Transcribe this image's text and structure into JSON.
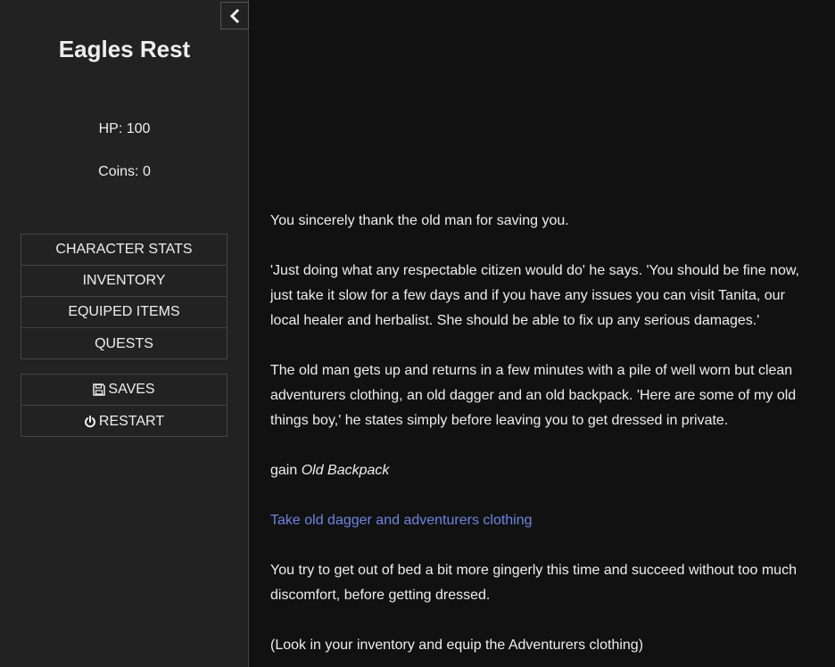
{
  "sidebar": {
    "title": "Eagles Rest",
    "hp": "HP: 100",
    "coins": "Coins: 0",
    "menu": {
      "character_stats": "CHARACTER STATS",
      "inventory": "INVENTORY",
      "equiped_items": "EQUIPED ITEMS",
      "quests": "QUESTS"
    },
    "system": {
      "saves": "SAVES",
      "restart": "RESTART"
    }
  },
  "passage": {
    "p1": "You sincerely thank the old man for saving you.",
    "p2": "'Just doing what any respectable citizen would do' he says. 'You should be fine now, just take it slow for a few days and if you have any issues you can visit Tanita, our local healer and herbalist. She should be able to fix up any serious damages.'",
    "p3": "The old man gets up and returns in a few minutes with a pile of well worn but clean adventurers clothing, an old dagger and an old backpack. 'Here are some of my old things boy,' he states simply before leaving you to get dressed in private.",
    "gain_prefix": "gain ",
    "gain_item": "Old Backpack",
    "link_text": "Take old dagger and adventurers clothing",
    "p4": "You try to get out of bed a bit more gingerly this time and succeed without too much discomfort, before getting dressed.",
    "p5": "(Look in your inventory and equip the Adventurers clothing)"
  },
  "colors": {
    "background": "#111111",
    "sidebar": "#222222",
    "link": "#6c85e0",
    "text": "#eeeeee"
  },
  "icons": {
    "collapse": "chevron-left-icon",
    "saves": "floppy-disk-icon",
    "restart": "power-icon"
  }
}
